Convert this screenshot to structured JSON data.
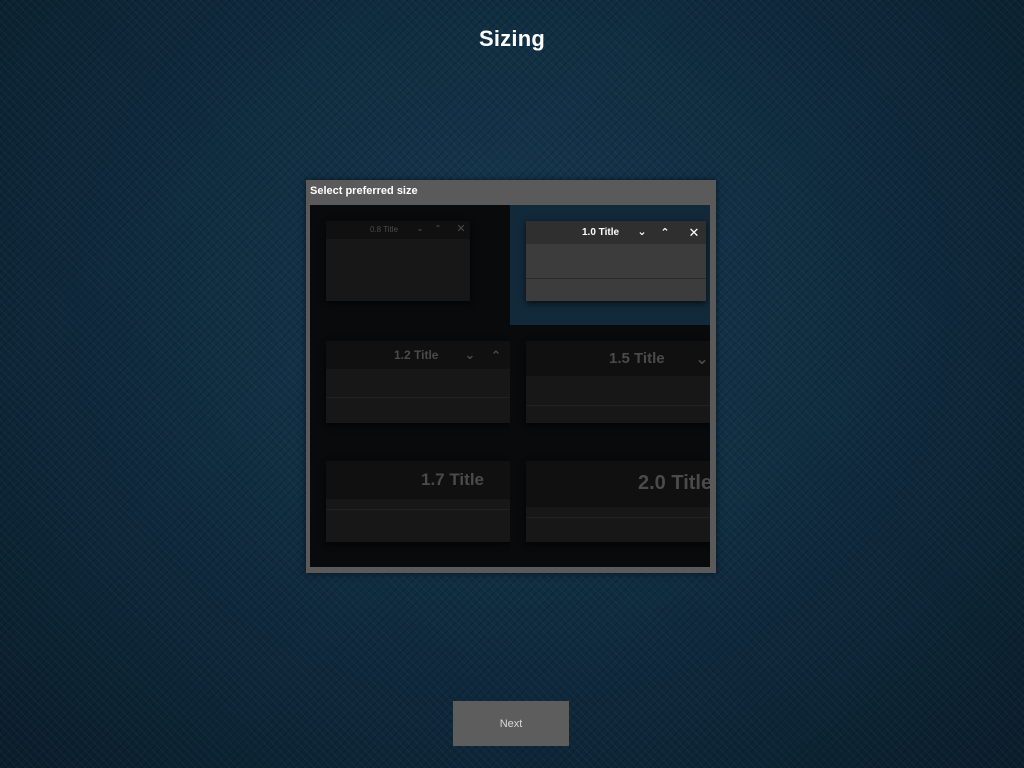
{
  "page": {
    "title": "Sizing"
  },
  "dialog": {
    "title": "Select preferred size",
    "selected_option": "1.0 Title",
    "options": [
      {
        "label": "0.8 Title",
        "selected": false
      },
      {
        "label": "1.0 Title",
        "selected": true
      },
      {
        "label": "1.2 Title",
        "selected": false
      },
      {
        "label": "1.5 Title",
        "selected": false
      },
      {
        "label": "1.7 Title",
        "selected": false
      },
      {
        "label": "2.0 Title",
        "selected": false
      }
    ],
    "icons": {
      "minimize": "chevron-down-icon",
      "maximize": "chevron-up-icon",
      "close": "close-icon"
    }
  },
  "footer": {
    "next_label": "Next"
  },
  "colors": {
    "background": "#0f2a3d",
    "dialog_frame": "#5a5a5a",
    "dialog_body": "#080a0c",
    "selected_cell": "#12293a",
    "button": "#5d5d5d"
  }
}
